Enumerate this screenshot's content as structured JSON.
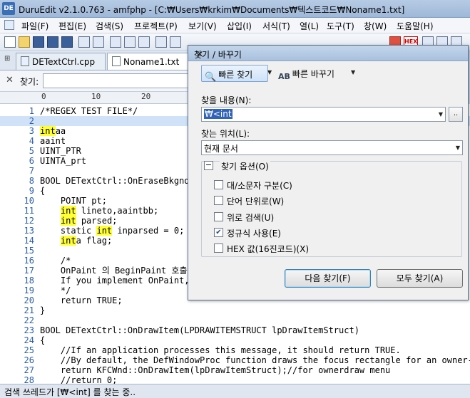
{
  "window": {
    "title": "DuruEdit v2.1.0.763 - amfphp - [C:₩Users₩krkim₩Documents₩텍스트코드₩Noname1.txt]",
    "app_icon": "DE"
  },
  "menu": [
    "파일(F)",
    "편집(E)",
    "검색(S)",
    "프로젝트(P)",
    "보기(V)",
    "삽입(I)",
    "서식(T)",
    "열(L)",
    "도구(T)",
    "창(W)",
    "도움말(H)"
  ],
  "toolbar": {
    "hex_label": "HEX"
  },
  "tabs": [
    {
      "label": "DETextCtrl.cpp"
    },
    {
      "label": "Noname1.txt"
    }
  ],
  "findbar": {
    "label": "찾기:"
  },
  "ruler": {
    "marks": [
      "0",
      "10",
      "20"
    ]
  },
  "editor": {
    "lines": [
      {
        "n": "1",
        "t": "/*REGEX TEST FILE*/"
      },
      {
        "n": "2",
        "t": ""
      },
      {
        "n": "3",
        "hl": "int",
        "t": "aa"
      },
      {
        "n": "4",
        "t": "aaint"
      },
      {
        "n": "5",
        "t": "UINT_PTR"
      },
      {
        "n": "6",
        "t": "UINTA_prt"
      },
      {
        "n": "7",
        "t": ""
      },
      {
        "n": "8",
        "t": "BOOL DETextCtrl::OnEraseBkgnd("
      },
      {
        "n": "9",
        "t": "{"
      },
      {
        "n": "10",
        "t": "    POINT pt;"
      },
      {
        "n": "11",
        "pre": "    ",
        "hl": "int",
        "t": " lineto,aaintbb;"
      },
      {
        "n": "12",
        "pre": "    ",
        "hl": "int",
        "t": " parsed;"
      },
      {
        "n": "13",
        "pre": "    static ",
        "hl": "int",
        "t": " inparsed = 0;"
      },
      {
        "n": "14",
        "pre": "    ",
        "hl": "int",
        "t": "a flag;"
      },
      {
        "n": "15",
        "t": ""
      },
      {
        "n": "16",
        "t": "    /*"
      },
      {
        "n": "17",
        "t": "    OnPaint 의 BeginPaint 호출"
      },
      {
        "n": "18",
        "t": "    If you implement OnPaint,r"
      },
      {
        "n": "19",
        "t": "    */"
      },
      {
        "n": "20",
        "t": "    return TRUE;"
      },
      {
        "n": "21",
        "t": "}"
      },
      {
        "n": "22",
        "t": ""
      },
      {
        "n": "23",
        "t": "BOOL DETextCtrl::OnDrawItem(LPDRAWITEMSTRUCT lpDrawItemStruct)"
      },
      {
        "n": "24",
        "t": "{"
      },
      {
        "n": "25",
        "t": "    //If an application processes this message, it should return TRUE."
      },
      {
        "n": "26",
        "t": "    //By default, the DefWindowProc function draws the focus rectangle for an owner-dr"
      },
      {
        "n": "27",
        "t": "    return KFCWnd::OnDrawItem(lpDrawItemStruct);//for ownerdraw menu"
      },
      {
        "n": "28",
        "t": "    //return 0;"
      }
    ]
  },
  "status": {
    "text": "검색 쓰레드가 [₩<int] 를 찾는 중.."
  },
  "dialog": {
    "title": "찾기 / 바꾸기",
    "mode_find": "빠른 찾기",
    "mode_replace": "빠른 바꾸기",
    "find_label": "찾을 내용(N):",
    "find_value": "₩<int",
    "dots_label": "..",
    "where_label": "찾는 위치(L):",
    "where_value": "현재 문서",
    "options_title": "찾기 옵션(O)",
    "options": [
      {
        "label": "대/소문자 구분(C)",
        "checked": false
      },
      {
        "label": "단어 단위로(W)",
        "checked": false
      },
      {
        "label": "위로 검색(U)",
        "checked": false
      },
      {
        "label": "정규식 사용(E)",
        "checked": true
      },
      {
        "label": "HEX 값(16진코드)(X)",
        "checked": false
      }
    ],
    "find_next": "다음 찾기(F)",
    "find_all": "모두 찾기(A)"
  }
}
